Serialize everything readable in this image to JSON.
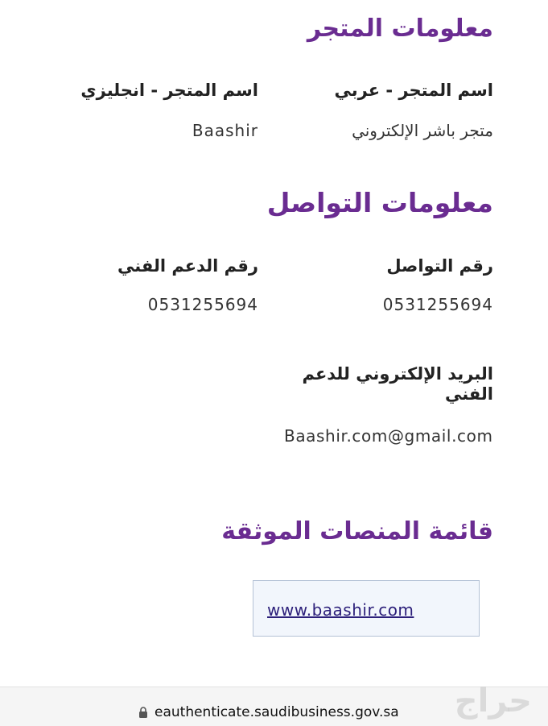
{
  "store_info": {
    "title": "معلومات المتجر",
    "arabic_name_label": "اسم المتجر - عربي",
    "arabic_name_value": "متجر باشر الإلكتروني",
    "english_name_label": "اسم المتجر - انجليزي",
    "english_name_value": "Baashir"
  },
  "contact_info": {
    "title": "معلومات التواصل",
    "contact_number_label": "رقم التواصل",
    "contact_number_value": "0531255694",
    "support_number_label": "رقم الدعم الفني",
    "support_number_value": "0531255694",
    "support_email_label": "البريد الإلكتروني للدعم الفني",
    "support_email_value": "Baashir.com@gmail.com"
  },
  "platforms": {
    "title": "قائمة المنصات الموثقة",
    "items": [
      "www.baashir.com"
    ]
  },
  "browser_bar": {
    "url": "eauthenticate.saudibusiness.gov.sa",
    "lock_icon": "lock-icon"
  },
  "watermark": {
    "text": "حراج"
  },
  "colors": {
    "heading": "#6a2c91",
    "link": "#2c1f7a",
    "platform_box_bg": "#f2f6fc",
    "platform_box_border": "#b4c2d6"
  }
}
